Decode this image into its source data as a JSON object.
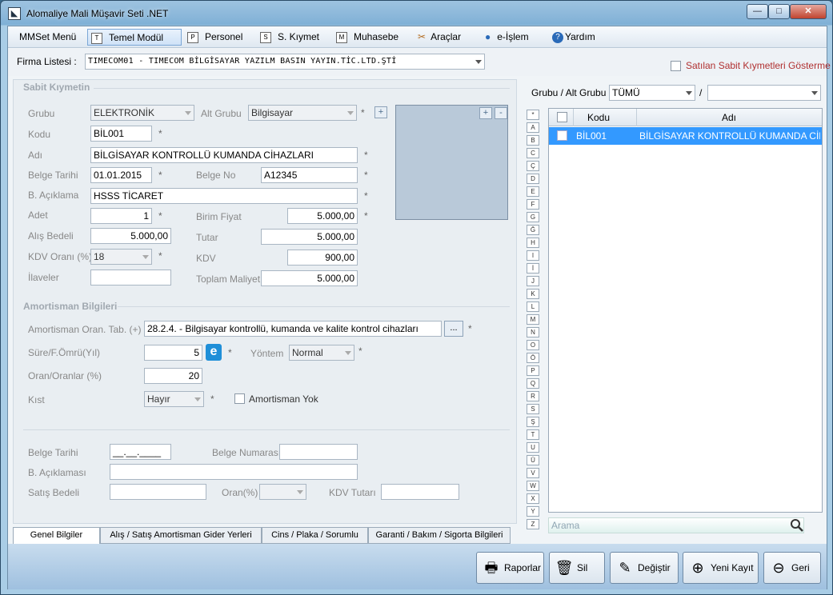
{
  "window": {
    "title": "Alomaliye Mali Müşavir Seti .NET",
    "controls": {
      "minimize": "—",
      "maximize": "□",
      "close": "✕"
    }
  },
  "menu": {
    "items": [
      {
        "label": "MMSet Menü",
        "icon": ""
      },
      {
        "label": "Temel Modül",
        "icon": "T"
      },
      {
        "label": "Personel",
        "icon": "P"
      },
      {
        "label": "S. Kıymet",
        "icon": "S"
      },
      {
        "label": "Muhasebe",
        "icon": "M"
      },
      {
        "label": "Araçlar",
        "icon": "tools-icon"
      },
      {
        "label": "e-İşlem",
        "icon": "globe-icon"
      },
      {
        "label": "Yardım",
        "icon": "help-icon"
      }
    ]
  },
  "firma": {
    "label": "Firma Listesi :",
    "value": "TIMECOM01       - TIMECOM BİLGİSAYAR YAZILM BASIN YAYIN.TİC.LTD.ŞTİ",
    "hide_sold_label": "Satılan Sabit Kıymetleri Gösterme"
  },
  "sabit": {
    "section_title": "Sabit Kıymetin",
    "grubu_label": "Grubu",
    "grubu_value": "ELEKTRONİK",
    "alt_grubu_label": "Alt Grubu",
    "alt_grubu_value": "Bilgisayar",
    "kodu_label": "Kodu",
    "kodu_value": "BİL001",
    "adi_label": "Adı",
    "adi_value": "BİLGİSAYAR KONTROLLÜ KUMANDA CİHAZLARI",
    "belge_tarihi_label": "Belge Tarihi",
    "belge_tarihi_value": "01.01.2015",
    "belge_no_label": "Belge No",
    "belge_no_value": "A12345",
    "aciklama_label": "B. Açıklama",
    "aciklama_value": "HSSS TİCARET",
    "adet_label": "Adet",
    "adet_value": "1",
    "birim_fiyat_label": "Birim Fiyat",
    "birim_fiyat_value": "5.000,00",
    "alis_bedeli_label": "Alış Bedeli",
    "alis_bedeli_value": "5.000,00",
    "tutar_label": "Tutar",
    "tutar_value": "5.000,00",
    "kdv_orani_label": "KDV Oranı (%)",
    "kdv_orani_value": "18",
    "kdv_label": "KDV",
    "kdv_value": "900,00",
    "ilaveler_label": "İlaveler",
    "ilaveler_value": "",
    "toplam_label": "Toplam Maliyet",
    "toplam_value": "5.000,00",
    "required_mark": "*",
    "plus": "+",
    "minus": "-"
  },
  "amortisman": {
    "section_title": "Amortisman Bilgileri",
    "oran_tab_label": "Amortisman Oran. Tab. (+)",
    "oran_tab_value": "28.2.4.   -   Bilgisayar kontrollü, kumanda ve kalite kontrol cihazları",
    "browse_label": "...",
    "sure_label": "Süre/F.Ömrü(Yıl)",
    "sure_value": "5",
    "yontem_label": "Yöntem",
    "yontem_value": "Normal",
    "oran_label": "Oran/Oranlar (%)",
    "oran_value": "20",
    "kist_label": "Kıst",
    "kist_value": "Hayır",
    "yok_label": "Amortisman Yok"
  },
  "satis": {
    "belge_tarihi_label": "Belge Tarihi",
    "belge_tarihi_value": "__.__.____",
    "belge_numarasi_label": "Belge Numarası",
    "aciklama_label": "B. Açıklaması",
    "satis_bedeli_label": "Satış Bedeli",
    "oran_label": "Oran(%)",
    "kdv_tutari_label": "KDV Tutarı"
  },
  "tabs": [
    {
      "label": "Genel Bilgiler"
    },
    {
      "label": "Alış / Satış Amortisman Gider Yerleri"
    },
    {
      "label": "Cins / Plaka / Sorumlu"
    },
    {
      "label": "Garanti / Bakım / Sigorta Bilgileri"
    }
  ],
  "right": {
    "grubu_label": "Grubu / Alt Grubu :",
    "grubu_value": "TÜMÜ",
    "slash": "/",
    "letters": [
      "*",
      "A",
      "B",
      "C",
      "Ç",
      "D",
      "E",
      "F",
      "G",
      "Ğ",
      "H",
      "I",
      "İ",
      "J",
      "K",
      "L",
      "M",
      "N",
      "O",
      "Ö",
      "P",
      "Q",
      "R",
      "S",
      "Ş",
      "T",
      "U",
      "Ü",
      "V",
      "W",
      "X",
      "Y",
      "Z"
    ],
    "columns": {
      "code": "Kodu",
      "name": "Adı"
    },
    "rows": [
      {
        "code": "BİL001",
        "name": "BİLGİSAYAR KONTROLLÜ KUMANDA CİH..."
      }
    ],
    "search_placeholder": "Arama"
  },
  "buttons": {
    "raporlar": "Raporlar",
    "sil": "Sil",
    "degistir": "Değiştir",
    "yeni_kayit": "Yeni Kayıt",
    "geri": "Geri"
  }
}
